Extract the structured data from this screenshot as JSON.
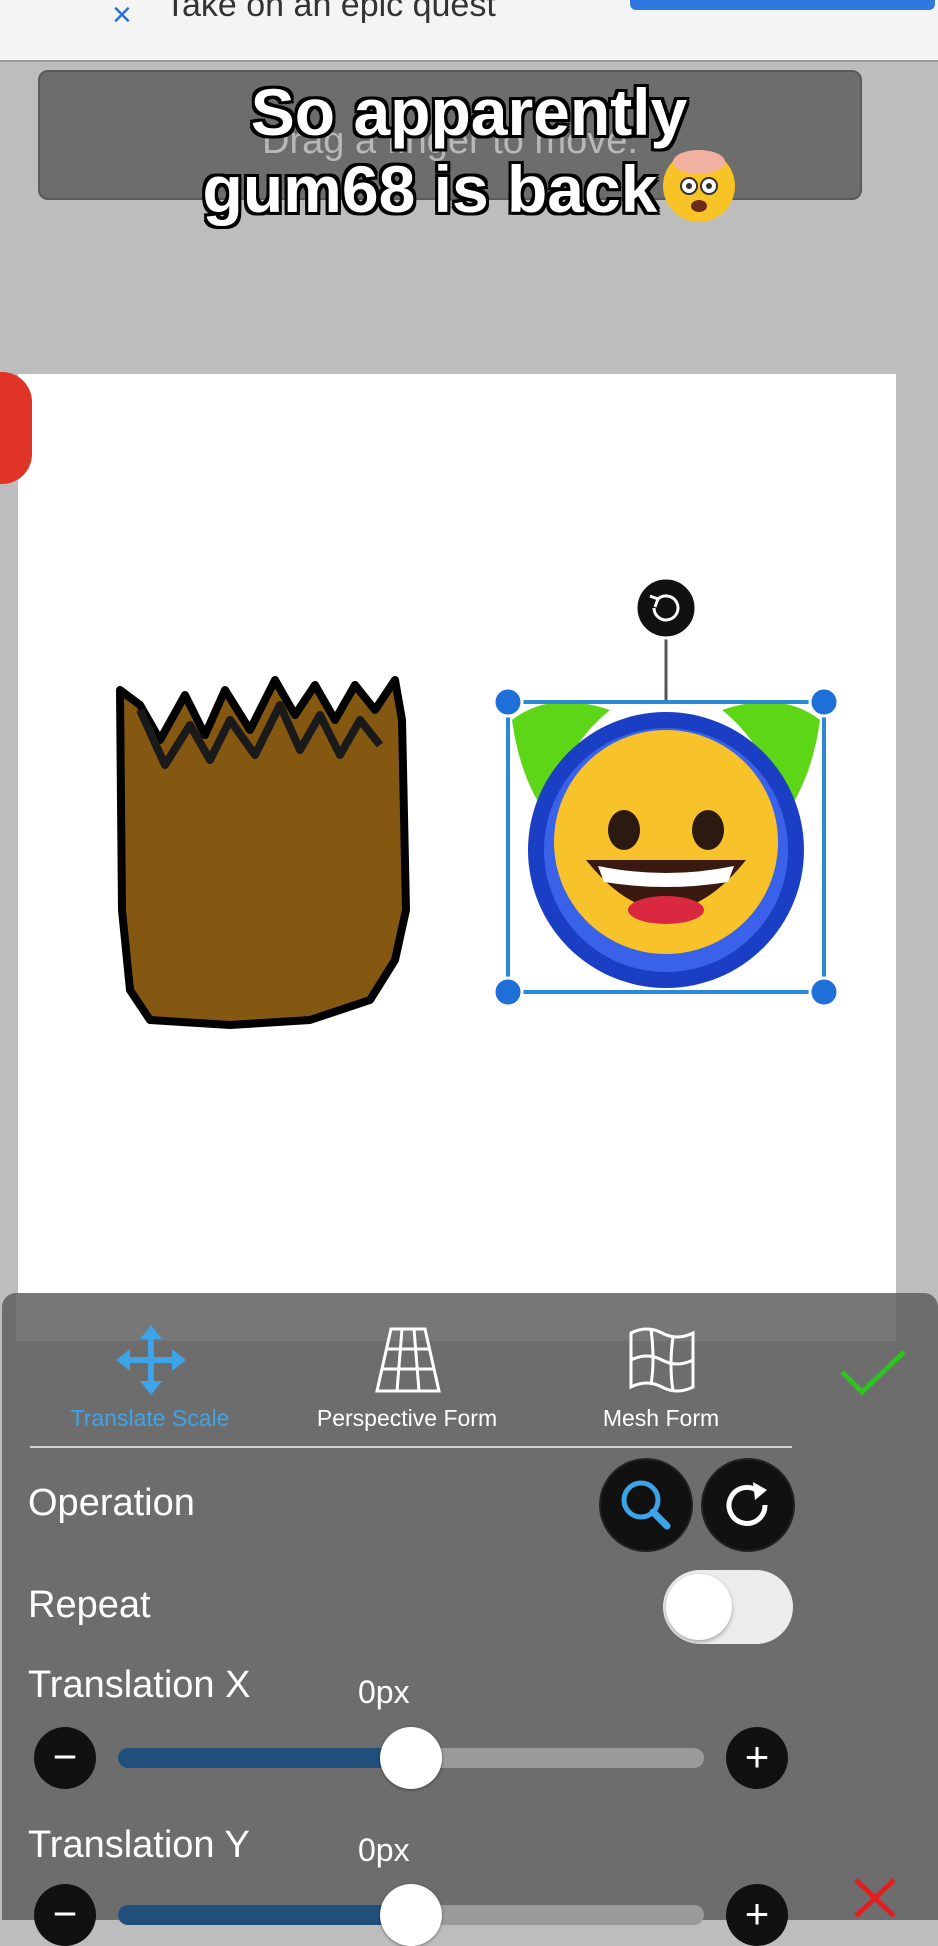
{
  "ad": {
    "close_glyph": "×",
    "text": "Take on an epic quest"
  },
  "hint": "Drag a finger to move.",
  "caption": {
    "line1": "So apparently",
    "line2": "gum68 is back"
  },
  "toolbar": {
    "tabs": [
      {
        "label": "Translate Scale",
        "icon": "move-arrows-icon",
        "active": true
      },
      {
        "label": "Perspective Form",
        "icon": "perspective-grid-icon",
        "active": false
      },
      {
        "label": "Mesh Form",
        "icon": "mesh-flag-icon",
        "active": false
      }
    ],
    "active_color": "#3da4e8",
    "confirm_color": "#2ec41e",
    "cancel_color": "#e02020"
  },
  "operation": {
    "label": "Operation",
    "buttons": [
      "zoom-icon",
      "rotate-icon"
    ]
  },
  "repeat": {
    "label": "Repeat",
    "enabled": false
  },
  "translation_x": {
    "label": "Translation X",
    "value": "0px",
    "slider_fraction": 0.5
  },
  "translation_y": {
    "label": "Translation Y",
    "value": "0px",
    "slider_fraction": 0.5
  }
}
